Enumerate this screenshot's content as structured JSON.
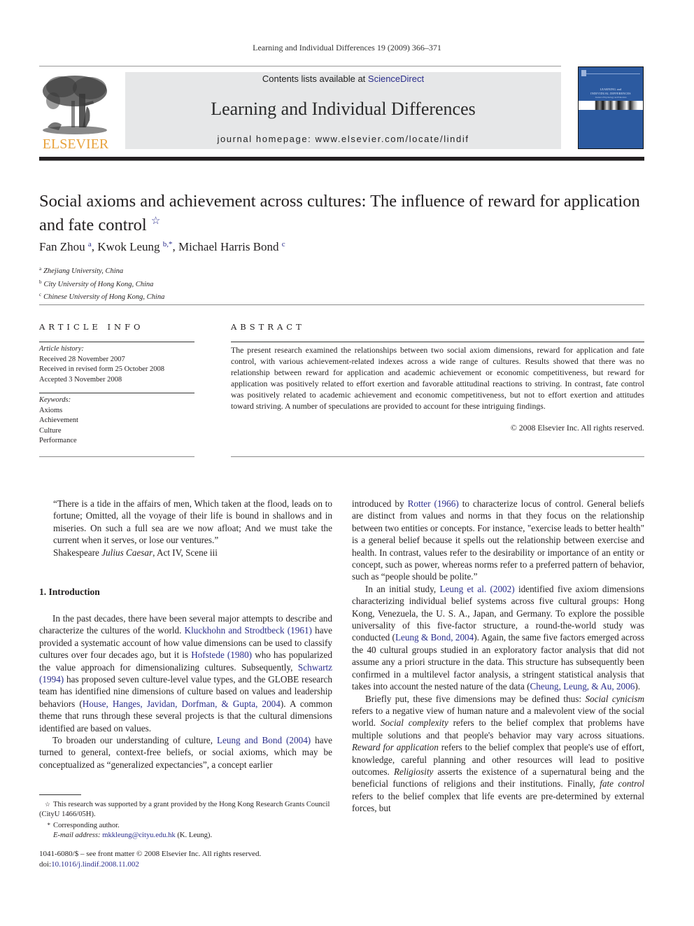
{
  "running_head": "Learning and Individual Differences 19 (2009) 366–371",
  "header": {
    "publisher_wordmark": "ELSEVIER",
    "contents_prefix": "Contents lists available at ",
    "contents_link": "ScienceDirect",
    "journal_title": "Learning and Individual Differences",
    "homepage": "journal homepage: www.elsevier.com/locate/lindif",
    "cover": {
      "title_line1": "LEARNING and",
      "title_line2": "INDIVIDUAL DIFFERENCES",
      "subtitle": "Journal of Psychology and Education",
      "color": "#2c5aa0"
    },
    "accent_color": "#e8a23c",
    "link_color": "#2b2e8c"
  },
  "article": {
    "title": "Social axioms and achievement across cultures: The influence of reward for application and fate control",
    "title_note_marker": "☆",
    "authors": [
      {
        "name": "Fan Zhou",
        "sup": "a"
      },
      {
        "name": "Kwok Leung",
        "sup": "b,*"
      },
      {
        "name": "Michael Harris Bond",
        "sup": "c"
      }
    ],
    "affiliations": [
      {
        "sup": "a",
        "text": "Zhejiang University, China"
      },
      {
        "sup": "b",
        "text": "City University of Hong Kong, China"
      },
      {
        "sup": "c",
        "text": "Chinese University of Hong Kong, China"
      }
    ]
  },
  "article_info": {
    "heading": "ARTICLE INFO",
    "history_label": "Article history:",
    "history": [
      "Received 28 November 2007",
      "Received in revised form 25 October 2008",
      "Accepted 3 November 2008"
    ],
    "keywords_label": "Keywords:",
    "keywords": [
      "Axioms",
      "Achievement",
      "Culture",
      "Performance"
    ]
  },
  "abstract": {
    "heading": "ABSTRACT",
    "text": "The present research examined the relationships between two social axiom dimensions, reward for application and fate control, with various achievement-related indexes across a wide range of cultures. Results showed that there was no relationship between reward for application and academic achievement or economic competitiveness, but reward for application was positively related to effort exertion and favorable attitudinal reactions to striving. In contrast, fate control was positively related to academic achievement and economic competitiveness, but not to effort exertion and attitudes toward striving. A number of speculations are provided to account for these intriguing findings.",
    "copyright": "© 2008 Elsevier Inc. All rights reserved."
  },
  "epigraph": {
    "text": "“There is a tide in the affairs of men, Which taken at the flood, leads on to fortune; Omitted, all the voyage of their life is bound in shallows and in miseries. On such a full sea are we now afloat; And we must take the current when it serves, or lose our ventures.”",
    "attribution_author": "Shakespeare ",
    "attribution_work": "Julius Caesar",
    "attribution_rest": ", Act IV, Scene iii"
  },
  "section1": {
    "heading": "1. Introduction",
    "p1": {
      "t1": "In the past decades, there have been several major attempts to describe and characterize the cultures of the world. ",
      "c1": "Kluckhohn and Strodtbeck (1961)",
      "t2": " have provided a systematic account of how value dimensions can be used to classify cultures over four decades ago, but it is ",
      "c2": "Hofstede (1980)",
      "t3": " who has popularized the value approach for dimensionalizing cultures. Subsequently, ",
      "c3": "Schwartz (1994)",
      "t4": " has proposed seven culture-level value types, and the GLOBE research team has identified nine dimensions of culture based on values and leadership behaviors (",
      "c4": "House, Hanges, Javidan, Dorfman, & Gupta, 2004",
      "t5": "). A common theme that runs through these several projects is that the cultural dimensions identified are based on values."
    },
    "p2": {
      "t1": "To broaden our understanding of culture, ",
      "c1": "Leung and Bond (2004)",
      "t2": " have turned to general, context-free beliefs, or social axioms, which may be conceptualized as “generalized expectancies”, a concept earlier"
    },
    "p2_cont": {
      "t1": "introduced by ",
      "c1": "Rotter (1966)",
      "t2": " to characterize locus of control. General beliefs are distinct from values and norms in that they focus on the relationship between two entities or concepts. For instance, \"exercise leads to better health\" is a general belief because it spells out the relationship between exercise and health. In contrast, values refer to the desirability or importance of an entity or concept, such as power, whereas norms refer to a preferred pattern of behavior, such as “people should be polite.”"
    },
    "p3": {
      "t1": "In an initial study, ",
      "c1": "Leung et al. (2002)",
      "t2": " identified five axiom dimensions characterizing individual belief systems across five cultural groups: Hong Kong, Venezuela, the U. S. A., Japan, and Germany. To explore the possible universality of this five-factor structure, a round-the-world study was conducted (",
      "c2": "Leung & Bond, 2004",
      "t3": "). Again, the same five factors emerged across the 40 cultural groups studied in an exploratory factor analysis that did not assume any a priori structure in the data. This structure has subsequently been confirmed in a multilevel factor analysis, a stringent statistical analysis that takes into account the nested nature of the data (",
      "c3": "Cheung, Leung, & Au, 2006",
      "t4": ")."
    },
    "p4": {
      "t1": "Briefly put, these five dimensions may be defined thus: ",
      "i1": "Social cynicism",
      "t2": " refers to a negative view of human nature and a malevolent view of the social world. ",
      "i2": "Social complexity",
      "t3": " refers to the belief complex that problems have multiple solutions and that people's behavior may vary across situations. ",
      "i3": "Reward for application",
      "t4": " refers to the belief complex that people's use of effort, knowledge, careful planning and other resources will lead to positive outcomes. ",
      "i4": "Religiosity",
      "t5": " asserts the existence of a supernatural being and the beneficial functions of religions and their institutions. Finally, ",
      "i5": "fate control",
      "t6": " refers to the belief complex that life events are pre-determined by external forces, but"
    }
  },
  "footnotes": {
    "fn1_marker": "☆",
    "fn1_text": "This research was supported by a grant provided by the Hong Kong Research Grants Council (CityU 1466/05H).",
    "fn2_marker": "*",
    "fn2_text": "Corresponding author.",
    "email_label": "E-mail address: ",
    "email": "mkkleung@cityu.edu.hk",
    "email_suffix": " (K. Leung)."
  },
  "front_matter": {
    "issn_line": "1041-6080/$ – see front matter © 2008 Elsevier Inc. All rights reserved.",
    "doi_label": "doi:",
    "doi": "10.1016/j.lindif.2008.11.002"
  }
}
